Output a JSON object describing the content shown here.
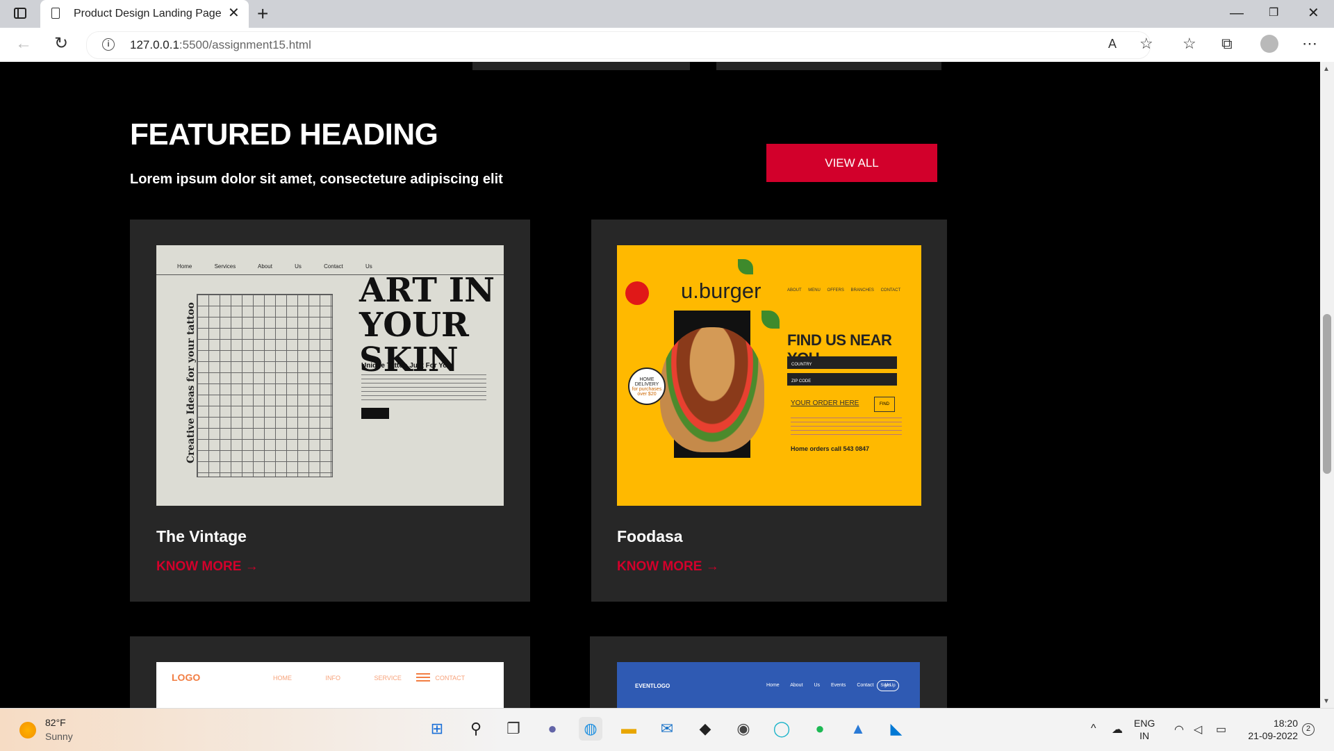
{
  "browser": {
    "tab_title": "Product Design Landing Page",
    "url_host": "127.0.0.1",
    "url_path": ":5500/assignment15.html",
    "new_tab_icon": "plus-icon",
    "close_icon": "close-icon"
  },
  "section": {
    "heading": "FEATURED HEADING",
    "subtitle": "Lorem ipsum dolor sit amet, consecteture adipiscing elit",
    "view_all_label": "VIEW ALL"
  },
  "cards": [
    {
      "title": "The Vintage",
      "link_label": "KNOW MORE →",
      "thumb": {
        "nav": "Home Services About Us Contact Us",
        "side_text": "Creative Ideas for your tattoo",
        "headline_1": "ART IN",
        "headline_2": "YOUR SKIN",
        "tagline": "Unique Tattoo Just For You!"
      }
    },
    {
      "title": "Foodasa",
      "link_label": "KNOW MORE →",
      "thumb": {
        "logo": "u.burger",
        "menu": "ABOUT MENU OFFERS BRANCHES CONTACT",
        "headline": "FIND US NEAR YOU",
        "select_1": "COUNTRY",
        "select_2": "ZIP CODE",
        "order_text": "YOUR ORDER HERE",
        "find_label": "FIND",
        "call_text": "Home orders call 543 0847",
        "delivery_1": "HOME DELIVERY",
        "delivery_2": "for purchases over $20"
      }
    },
    {
      "thumb": {
        "logo": "LOGO",
        "menu": "HOME INFO SERVICE CONTACT"
      }
    },
    {
      "thumb": {
        "logo": "EVENTLOGO",
        "menu": "Home About Us Events Contact Us",
        "signup": "Sign Up"
      }
    }
  ],
  "taskbar": {
    "temperature": "82°F",
    "condition": "Sunny",
    "lang_1": "ENG",
    "lang_2": "IN",
    "time": "18:20",
    "date": "21-09-2022",
    "notifications": "2"
  },
  "colors": {
    "accent_red": "#d2002b",
    "card_bg": "#272727",
    "page_bg": "#000000"
  }
}
